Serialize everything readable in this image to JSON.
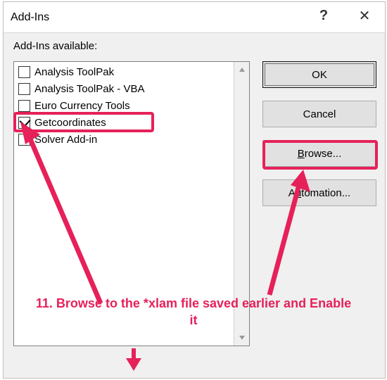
{
  "dialog": {
    "title": "Add-Ins",
    "help_tooltip": "?",
    "close_tooltip": "✕",
    "list_label": "Add-Ins available:"
  },
  "items": [
    {
      "label": "Analysis ToolPak",
      "checked": false
    },
    {
      "label": "Analysis ToolPak - VBA",
      "checked": false
    },
    {
      "label": "Euro Currency Tools",
      "checked": false
    },
    {
      "label": "Getcoordinates",
      "checked": true
    },
    {
      "label": "Solver Add-in",
      "checked": false
    }
  ],
  "buttons": {
    "ok": "OK",
    "cancel": "Cancel",
    "browse": "Browse...",
    "automation": "Automation..."
  },
  "annotation": {
    "text": "11. Browse to the *xlam file saved earlier and Enable it"
  },
  "colors": {
    "accent": "#e6215a"
  }
}
